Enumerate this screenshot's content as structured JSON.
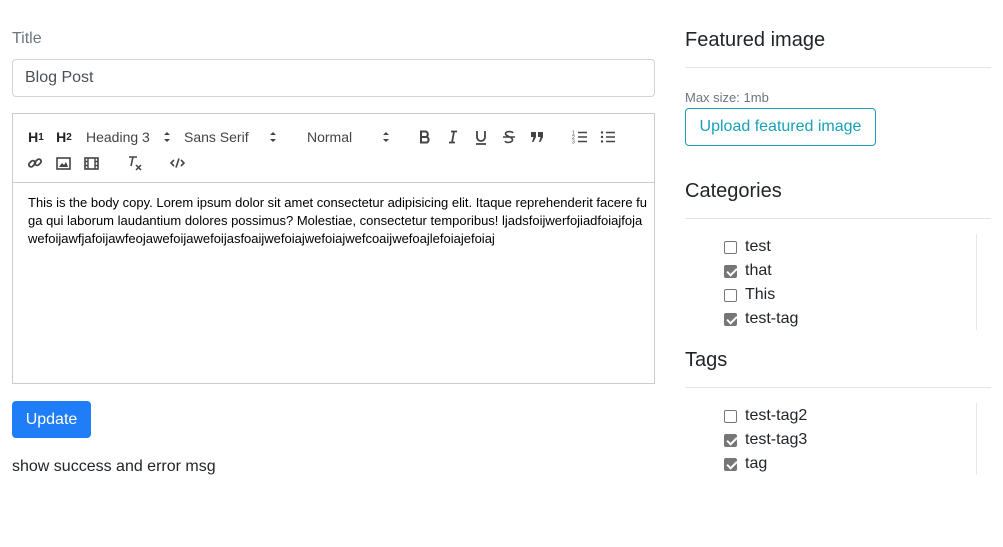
{
  "post": {
    "title_label": "Title",
    "title_value": "Blog Post",
    "body_text": "This is the body copy. Lorem ipsum dolor sit amet consectetur adipisicing elit. Itaque reprehenderit facere fuga qui laborum laudantium dolores possimus? Molestiae, consectetur temporibus! ljadsfoijwerfojiadfoiajfojawefoijawfjafoijawfeojawefoijawefoijasfoaijwefoiajwefoiajwefcoaijwefoajlefoiajefoiaj"
  },
  "toolbar": {
    "h1_label": "H1",
    "h2_label": "H2",
    "header_select": "Heading 3",
    "font_select": "Sans Serif",
    "size_select": "Normal",
    "icons": [
      "header-1-icon",
      "header-2-icon",
      "bold-icon",
      "italic-icon",
      "underline-icon",
      "strike-icon",
      "blockquote-icon",
      "ordered-list-icon",
      "bullet-list-icon",
      "link-icon",
      "image-icon",
      "video-icon",
      "clear-format-icon",
      "code-icon"
    ]
  },
  "actions": {
    "update_label": "Update",
    "status_msg": "show success and error msg"
  },
  "featured": {
    "heading": "Featured image",
    "max_size": "Max size: 1mb",
    "upload_label": "Upload featured image"
  },
  "categories": {
    "heading": "Categories",
    "items": [
      {
        "label": "test",
        "checked": false
      },
      {
        "label": "that",
        "checked": true
      },
      {
        "label": "This",
        "checked": false
      },
      {
        "label": "test-tag",
        "checked": true
      }
    ]
  },
  "tags": {
    "heading": "Tags",
    "items": [
      {
        "label": "test-tag2",
        "checked": false
      },
      {
        "label": "test-tag3",
        "checked": true
      },
      {
        "label": "tag",
        "checked": true
      }
    ]
  },
  "colors": {
    "primary": "#1f7df8",
    "info": "#17a2b8",
    "muted": "#6c757d"
  }
}
